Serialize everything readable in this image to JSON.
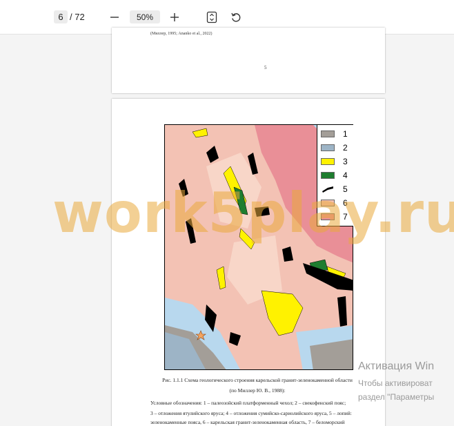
{
  "toolbar": {
    "page_current": "6",
    "page_total": "/ 72",
    "zoom": "50%"
  },
  "page_above": {
    "cut_text": "(Миллер, 1995; Ananko et al., 2022)",
    "page_number": "5"
  },
  "figure": {
    "legend": [
      {
        "label": "1",
        "color": "#a39e98"
      },
      {
        "label": "2",
        "color": "#9db4c6"
      },
      {
        "label": "3",
        "color": "#fff200"
      },
      {
        "label": "4",
        "color": "#1e7d2f"
      },
      {
        "label": "5",
        "color": "#000000"
      },
      {
        "label": "6",
        "color": "#f3c2b4"
      },
      {
        "label": "7",
        "color": "#e98f97"
      }
    ],
    "caption_line1": "Рис. 1.1.1 Схема геологического строения карельской гранит-зеленокаменной области",
    "caption_line2": "(по Миллер Ю. В., 1988):",
    "legend_text": [
      "Условные обозначения: 1 – палеозойский платформенный чехол; 2 – свекофенский пояс;",
      "3 – отложения ятулийского яруса; 4 – отложения сумийско-сариолийского яруса, 5 – лопий:",
      "зеленокаменные пояса, 6 – карельская гранит-зеленокаменная область, 7 – беломорский"
    ]
  },
  "watermark": "work5play.ru",
  "os_activation": {
    "title": "Активация Win",
    "line1": "Чтобы активироват",
    "line2": "раздел \"Параметры"
  }
}
